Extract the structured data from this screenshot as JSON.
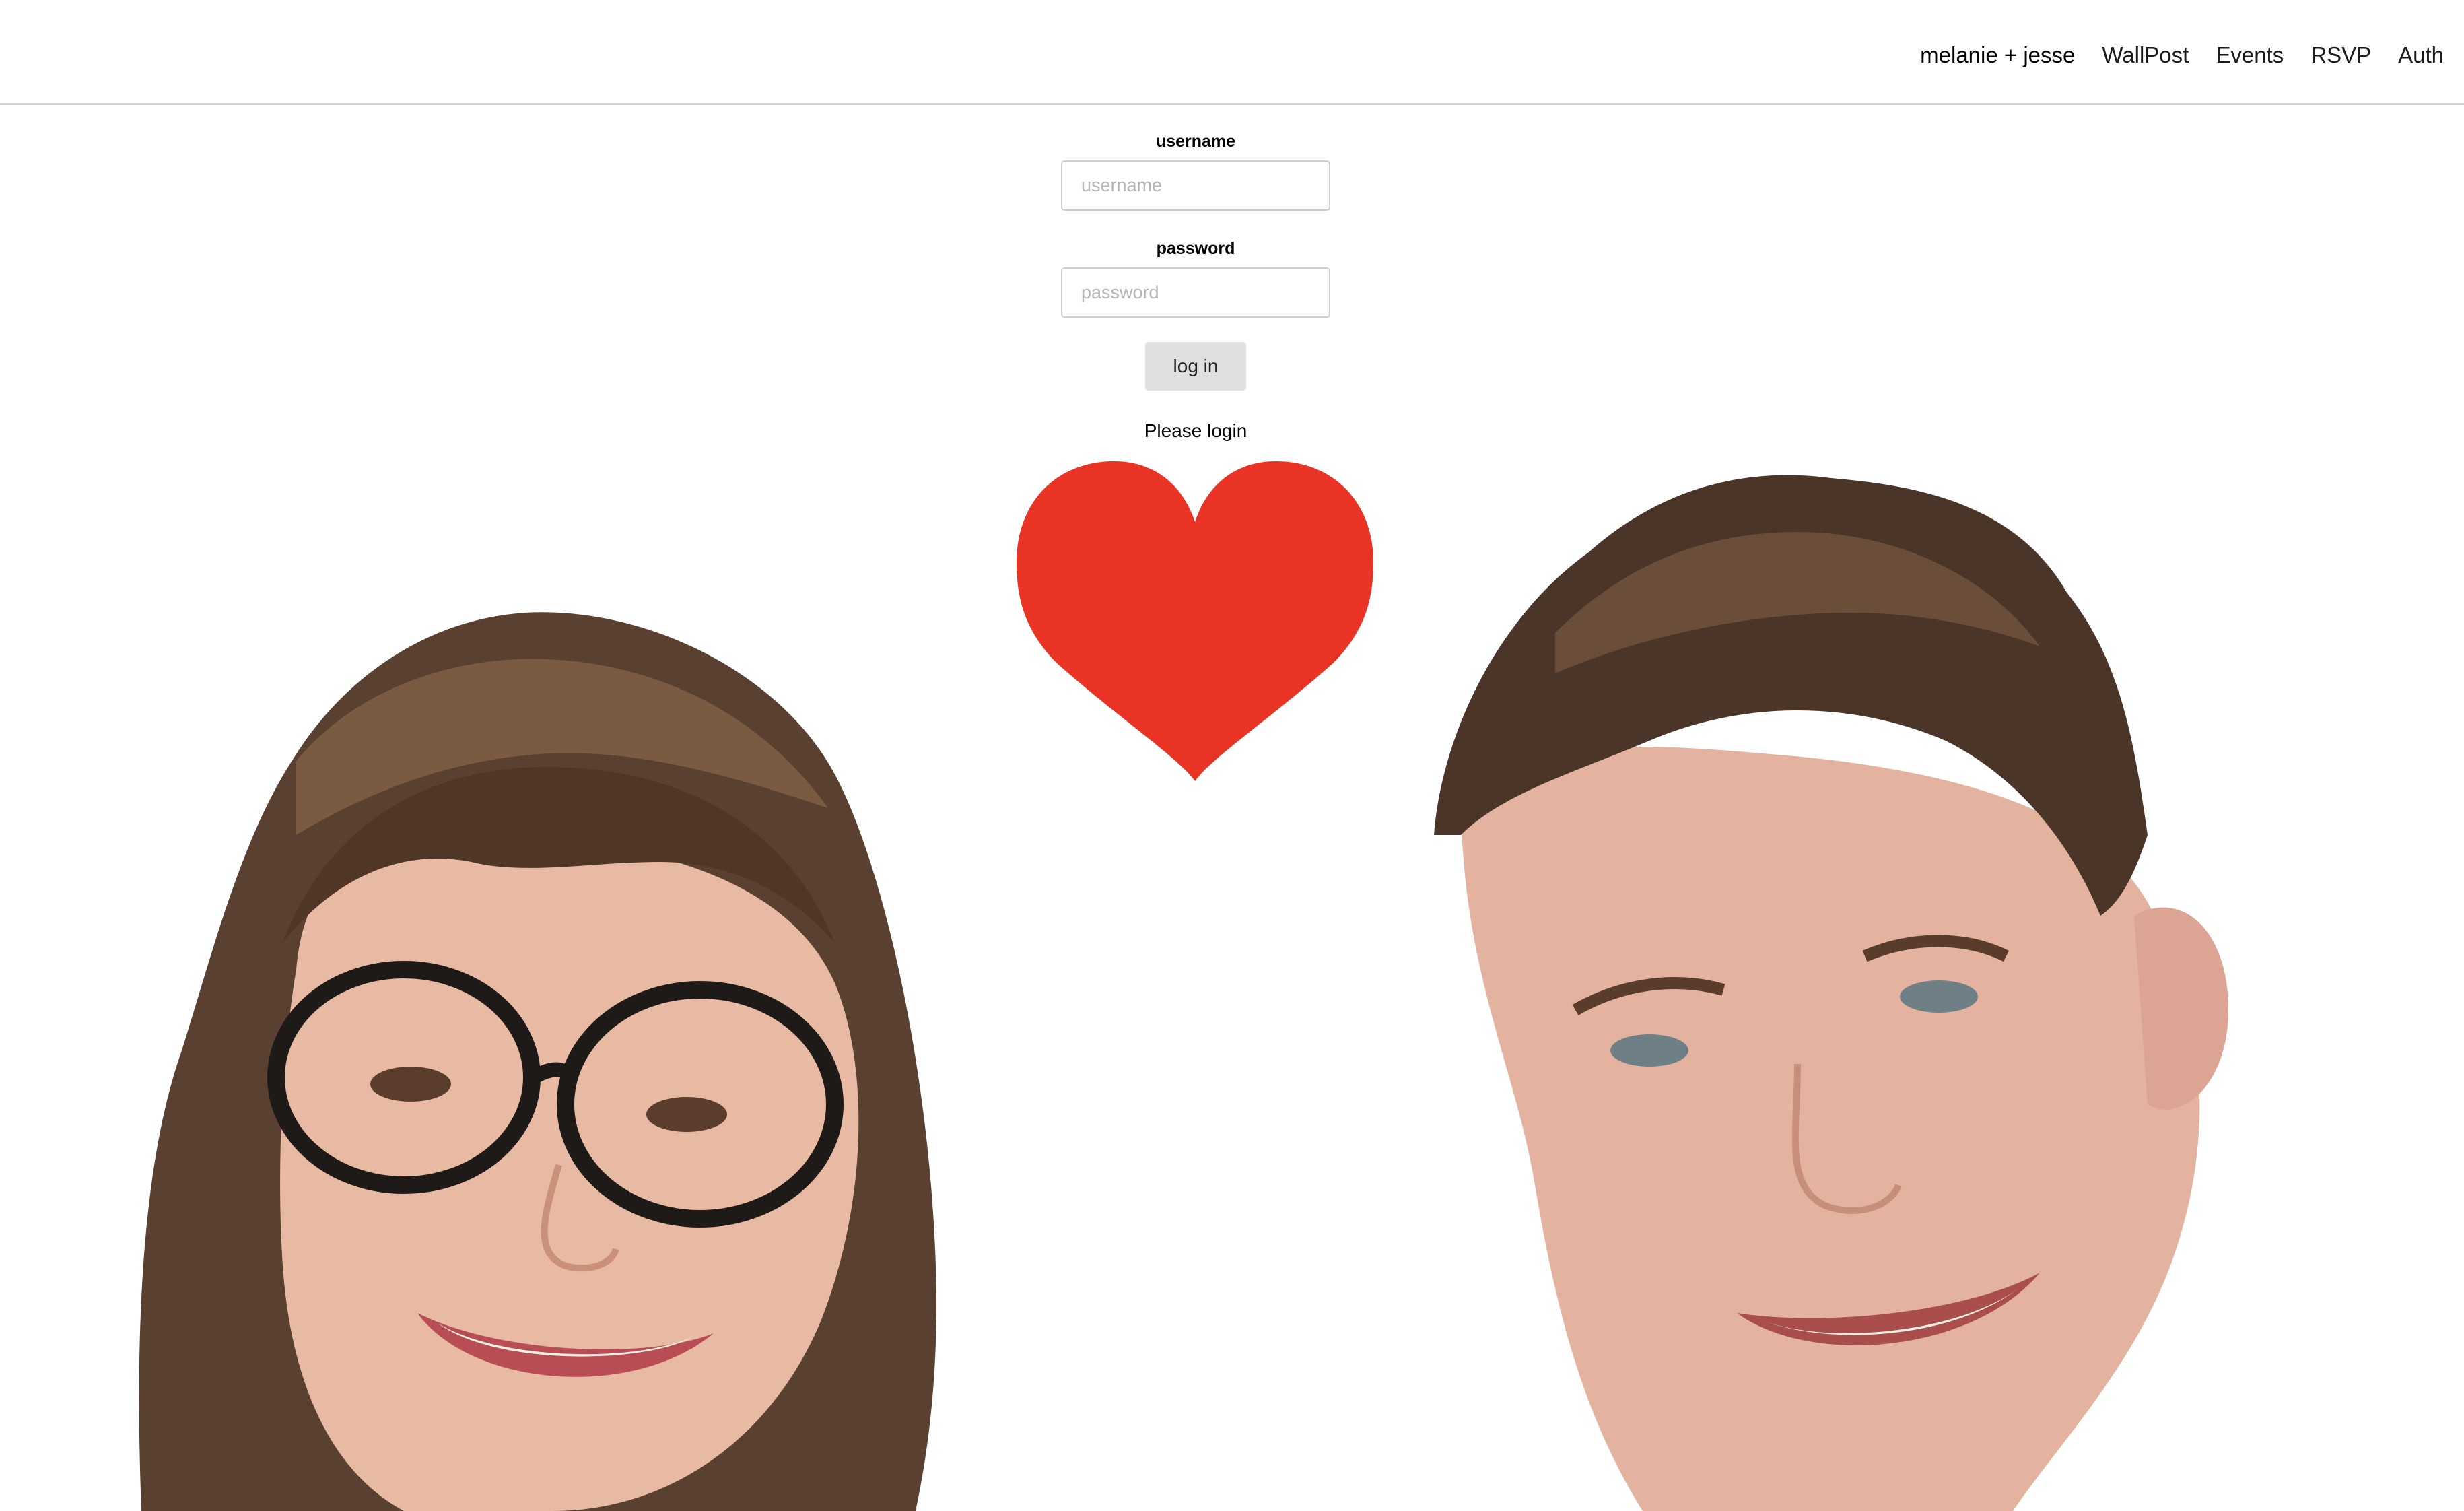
{
  "nav": {
    "brand": "melanie + jesse",
    "items": [
      "WallPost",
      "Events",
      "RSVP",
      "Auth"
    ]
  },
  "login": {
    "username_label": "username",
    "username_placeholder": "username",
    "username_value": "",
    "password_label": "password",
    "password_placeholder": "password",
    "password_value": "",
    "submit_label": "log in",
    "status": "Please login"
  },
  "colors": {
    "heart": "#e93324",
    "button_bg": "#e0e0e0",
    "divider": "#d6d6d6"
  },
  "icons": {
    "heart": "heart-icon"
  }
}
